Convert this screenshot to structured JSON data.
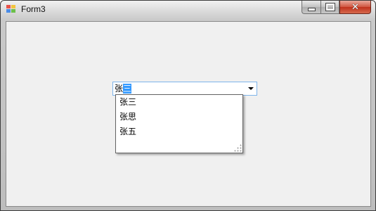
{
  "window": {
    "title": "Form3",
    "buttons": {
      "minimize": "minimize-icon",
      "maximize": "maximize-icon",
      "close": "close-icon"
    }
  },
  "combo": {
    "typed_text": "张",
    "selected_text": "三",
    "arrow": "chevron-down-icon"
  },
  "dropdown": {
    "items": [
      {
        "label": "张三"
      },
      {
        "label": "张思"
      },
      {
        "label": "张五"
      }
    ]
  },
  "colors": {
    "selection": "#3399ff",
    "combo_border": "#7eb4ea",
    "close_button": "#c0311c",
    "client_background": "#f0f0f0"
  }
}
